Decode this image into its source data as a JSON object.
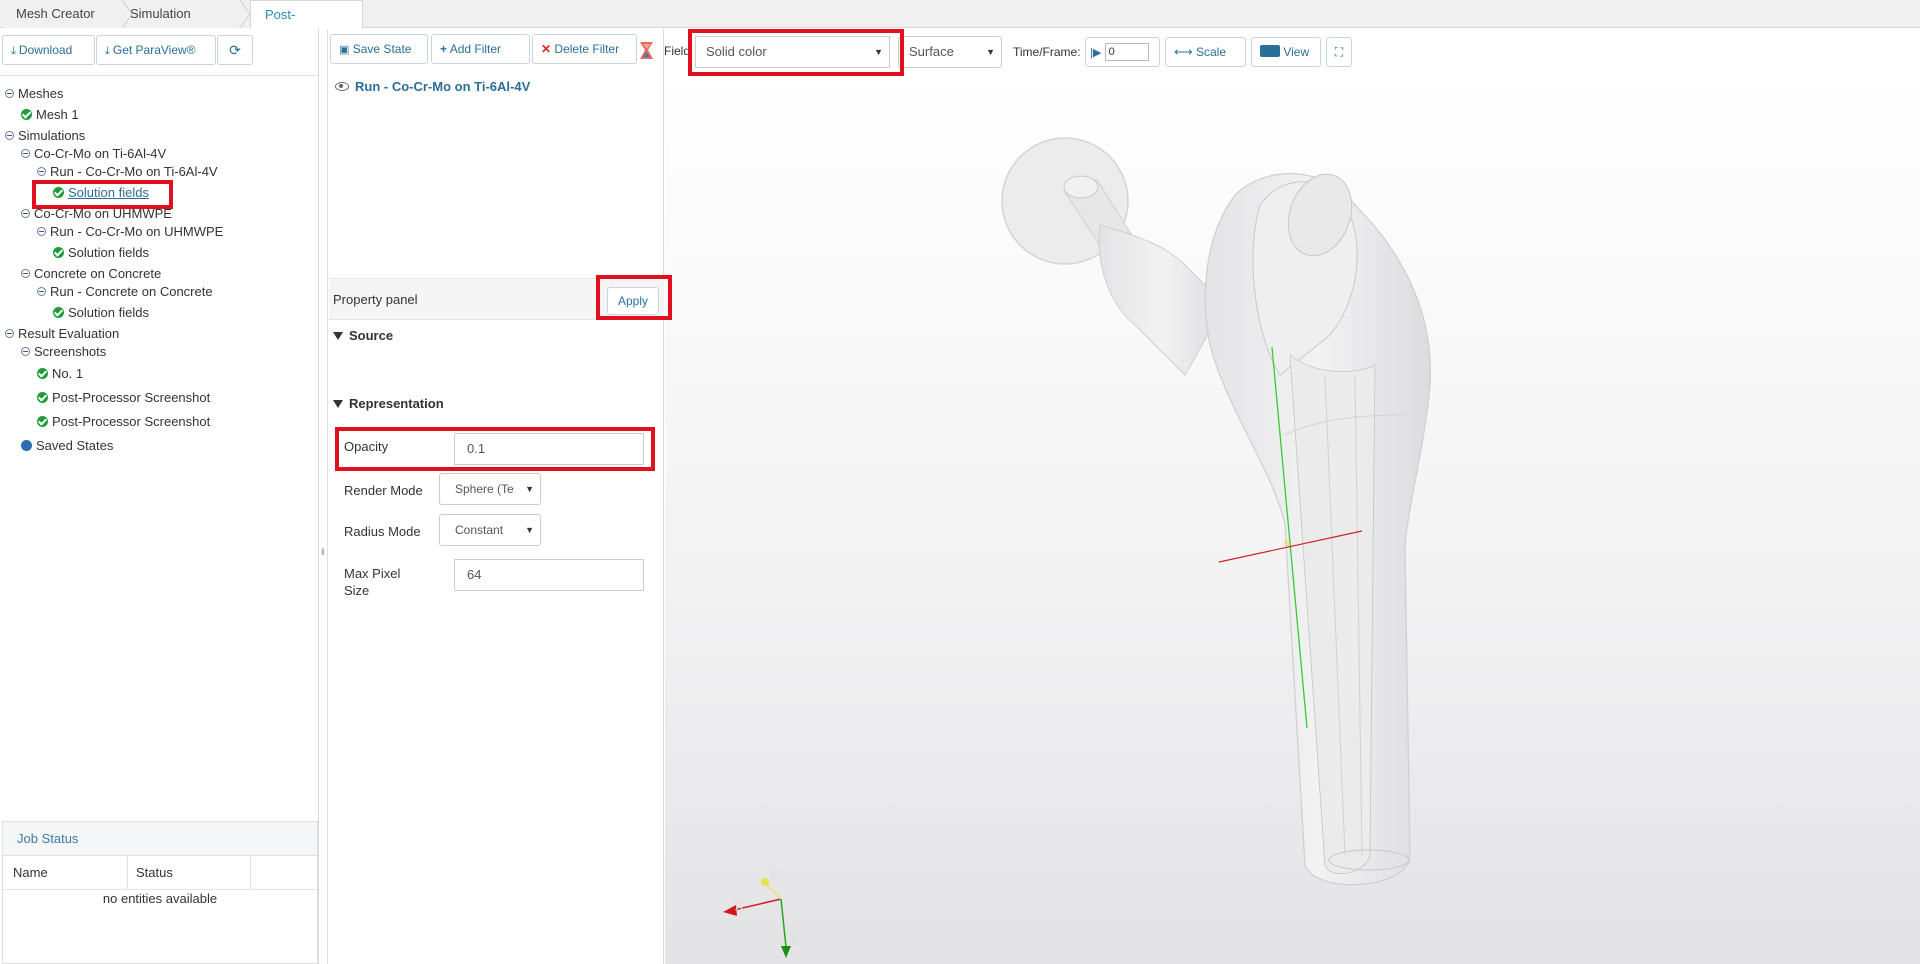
{
  "tabs": {
    "mesh_creator": "Mesh Creator",
    "simulation_designer": "Simulation Designer",
    "post_processor": "Post-Processor"
  },
  "left_toolbar": {
    "download": "Download",
    "get_paraview": "Get ParaView®"
  },
  "tree": {
    "meshes": "Meshes",
    "mesh1": "Mesh 1",
    "simulations": "Simulations",
    "sim1": "Co-Cr-Mo on Ti-6Al-4V",
    "sim1_run": "Run - Co-Cr-Mo on Ti-6Al-4V",
    "sim1_fields": "Solution fields",
    "sim2": "Co-Cr-Mo on UHMWPE",
    "sim2_run": "Run - Co-Cr-Mo on UHMWPE",
    "sim2_fields": "Solution fields",
    "sim3": "Concrete on Concrete",
    "sim3_run": "Run - Concrete on Concrete",
    "sim3_fields": "Solution fields",
    "result_eval": "Result Evaluation",
    "screenshots": "Screenshots",
    "shot1": "No. 1",
    "shot2": "Post-Processor Screenshot",
    "shot3": "Post-Processor Screenshot",
    "saved_states": "Saved States"
  },
  "job_status": {
    "title": "Job Status",
    "col_name": "Name",
    "col_status": "Status",
    "empty": "no entities available"
  },
  "mid_toolbar": {
    "save_state": "Save State",
    "add_filter": "Add Filter",
    "delete_filter": "Delete Filter"
  },
  "pipeline": {
    "item": "Run - Co-Cr-Mo on Ti-6Al-4V"
  },
  "property_panel": {
    "title": "Property panel",
    "apply": "Apply",
    "source": "Source",
    "representation": "Representation",
    "opacity_label": "Opacity",
    "opacity_value": "0.1",
    "render_mode_label": "Render Mode",
    "render_mode_value": "Sphere (Te",
    "radius_mode_label": "Radius Mode",
    "radius_mode_value": "Constant",
    "max_pixel_label_1": "Max Pixel",
    "max_pixel_label_2": "Size",
    "max_pixel_value": "64"
  },
  "main_toolbar": {
    "field_label": "Field",
    "field_value": "Solid color",
    "representation_value": "Surface",
    "time_frame_label": "Time/Frame:",
    "time_frame_value": "0",
    "scale": "Scale",
    "view": "View"
  },
  "axes": {
    "x": "X",
    "y": "Y",
    "z": "Z"
  },
  "colors": {
    "accent": "#2a6f97",
    "highlight": "#e0101e",
    "check": "#1e9d3a"
  }
}
